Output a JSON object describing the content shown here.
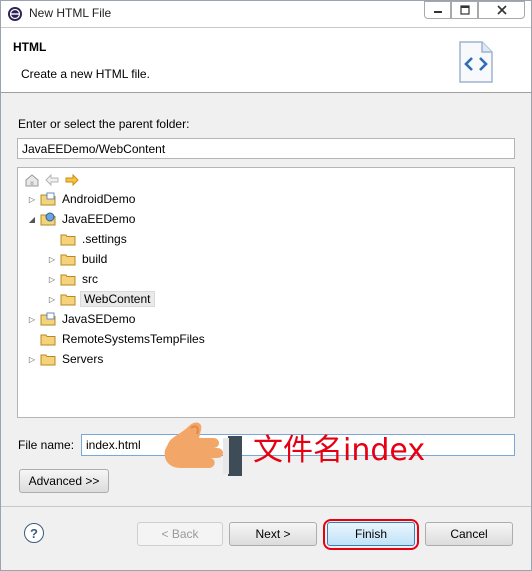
{
  "window": {
    "title": "New HTML File"
  },
  "header": {
    "title": "HTML",
    "description": "Create a new HTML file."
  },
  "parent_folder": {
    "label": "Enter or select the parent folder:",
    "value": "JavaEEDemo/WebContent"
  },
  "tree": {
    "items": [
      {
        "label": "AndroidDemo",
        "icon": "project-icon",
        "expanded": false
      },
      {
        "label": "JavaEEDemo",
        "icon": "web-project-icon",
        "expanded": true
      },
      {
        "label": ".settings",
        "icon": "folder-icon"
      },
      {
        "label": "build",
        "icon": "folder-icon",
        "expanded": false
      },
      {
        "label": "src",
        "icon": "folder-icon",
        "expanded": false
      },
      {
        "label": "WebContent",
        "icon": "folder-icon",
        "expanded": false,
        "selected": true
      },
      {
        "label": "JavaSEDemo",
        "icon": "project-icon",
        "expanded": false
      },
      {
        "label": "RemoteSystemsTempFiles",
        "icon": "folder-icon"
      },
      {
        "label": "Servers",
        "icon": "folder-icon",
        "expanded": false
      }
    ]
  },
  "file_name": {
    "label": "File name:",
    "value": "index.html"
  },
  "annotation": {
    "text": "文件名index",
    "color": "#e60012"
  },
  "buttons": {
    "advanced": "Advanced >>",
    "back": "< Back",
    "next": "Next >",
    "finish": "Finish",
    "cancel": "Cancel",
    "help": "?"
  }
}
